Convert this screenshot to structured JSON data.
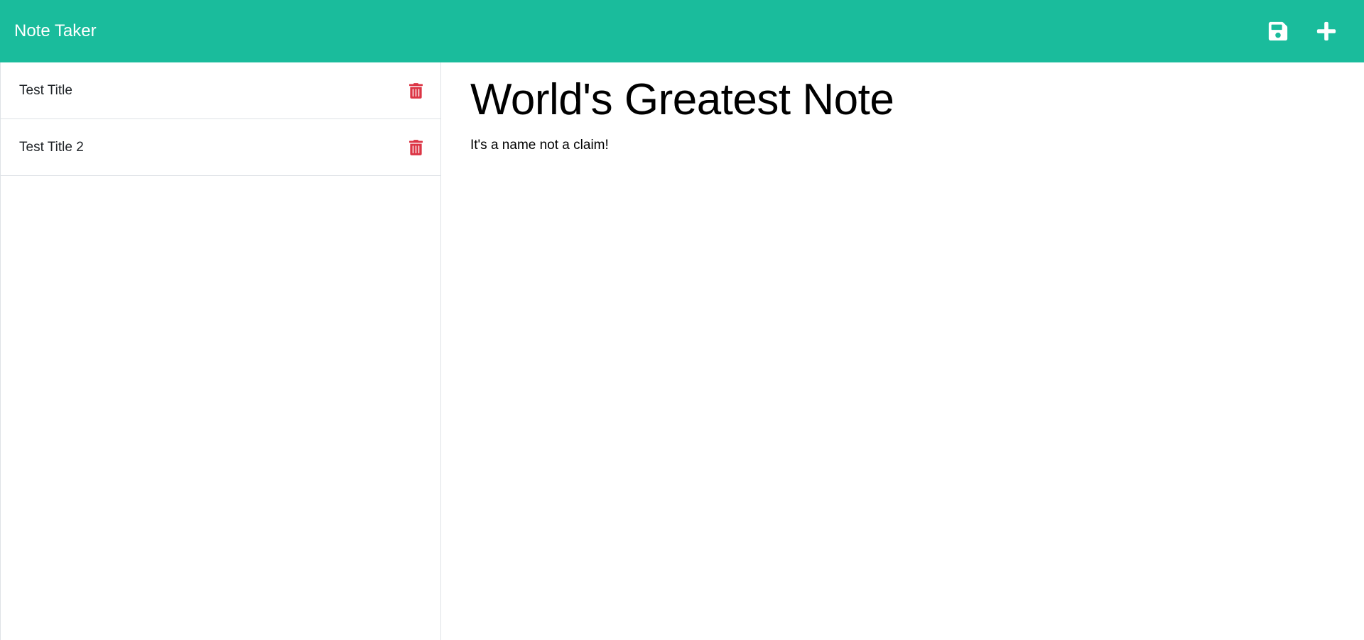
{
  "app": {
    "brand": "Note Taker"
  },
  "toolbar": {
    "save_icon": "save-icon",
    "new_icon": "plus-icon"
  },
  "notes": [
    {
      "title": "Test Title",
      "delete_icon": "trash-icon"
    },
    {
      "title": "Test Title 2",
      "delete_icon": "trash-icon"
    }
  ],
  "active_note": {
    "title": "World's Greatest Note",
    "text": "It's a name not a claim!"
  },
  "colors": {
    "brand": "#1abc9c",
    "delete": "#dc3545",
    "text": "#212529"
  }
}
